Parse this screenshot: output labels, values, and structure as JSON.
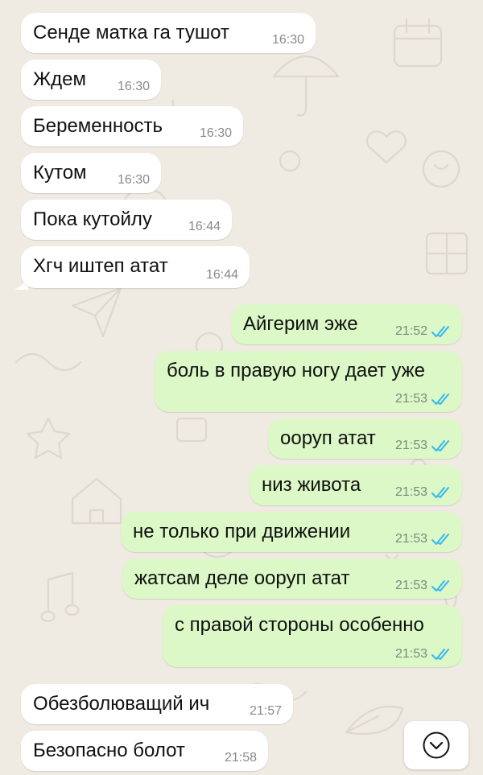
{
  "colors": {
    "wallpaper": "#efeae2",
    "incoming_bubble": "#ffffff",
    "outgoing_bubble": "#dcf8c6",
    "read_ticks": "#34b7f1"
  },
  "messages": [
    {
      "direction": "incoming",
      "text": "Сенде матка га тушот",
      "time": "16:30"
    },
    {
      "direction": "incoming",
      "text": "Ждем",
      "time": "16:30"
    },
    {
      "direction": "incoming",
      "text": "Беременность",
      "time": "16:30"
    },
    {
      "direction": "incoming",
      "text": "Кутом",
      "time": "16:30"
    },
    {
      "direction": "incoming",
      "text": "Пока кутойлу",
      "time": "16:44"
    },
    {
      "direction": "incoming",
      "text": "Хгч иштеп атат",
      "time": "16:44"
    },
    {
      "direction": "outgoing",
      "text": "Айгерим эже",
      "time": "21:52",
      "status": "read"
    },
    {
      "direction": "outgoing",
      "text": "боль в правую ногу дает уже",
      "time": "21:53",
      "status": "read"
    },
    {
      "direction": "outgoing",
      "text": "ооруп атат",
      "time": "21:53",
      "status": "read"
    },
    {
      "direction": "outgoing",
      "text": "низ живота",
      "time": "21:53",
      "status": "read"
    },
    {
      "direction": "outgoing",
      "text": "не только при движении",
      "time": "21:53",
      "status": "read"
    },
    {
      "direction": "outgoing",
      "text": "жатсам деле ооруп атат",
      "time": "21:53",
      "status": "read"
    },
    {
      "direction": "outgoing",
      "text": "с правой стороны особенно",
      "time": "21:53",
      "status": "read"
    },
    {
      "direction": "incoming",
      "text": "Обезболюващий ич",
      "time": "21:57"
    },
    {
      "direction": "incoming",
      "text": "Безопасно болот",
      "time": "21:58"
    }
  ],
  "scroll_button": {
    "icon": "chevron-down-icon"
  }
}
